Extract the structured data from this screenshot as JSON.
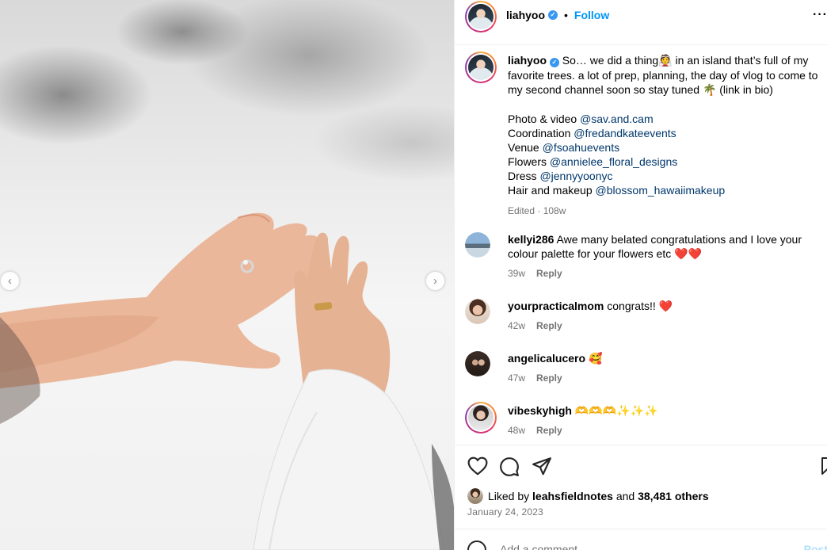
{
  "header": {
    "username": "liahyoo",
    "follow_label": "Follow",
    "separator": "•",
    "more": "···"
  },
  "caption": {
    "username": "liahyoo",
    "line1_a": "So… we did a thing",
    "line1_b": " in an island that’s full of my favorite trees. a lot of prep, planning, the day of vlog to come to my second channel soon so stay tuned ",
    "line1_c": " (link in bio)",
    "credits": [
      {
        "label": "Photo & video ",
        "handle": "@sav.and.cam"
      },
      {
        "label": "Coordination ",
        "handle": "@fredandkateevents"
      },
      {
        "label": "Venue ",
        "handle": "@fsoahuevents"
      },
      {
        "label": "Flowers ",
        "handle": "@annielee_floral_designs"
      },
      {
        "label": "Dress ",
        "handle": "@jennyyoonyc"
      },
      {
        "label": "Hair and makeup ",
        "handle": "@blossom_hawaiimakeup"
      }
    ],
    "meta": "Edited · 108w"
  },
  "comments": [
    {
      "username": "kellyi286",
      "text": "Awe many belated congratulations and I love your colour palette for your flowers etc ",
      "emoji": "❤️❤️",
      "age": "39w",
      "reply": "Reply"
    },
    {
      "username": "yourpracticalmom",
      "text": "congrats!! ",
      "emoji": "❤️",
      "age": "42w",
      "reply": "Reply"
    },
    {
      "username": "angelicalucero",
      "text": "",
      "emoji": "🥰",
      "age": "47w",
      "reply": "Reply"
    },
    {
      "username": "vibeskyhigh",
      "text": "",
      "emoji": "🫶🫶🫶✨✨✨",
      "age": "48w",
      "reply": "Reply"
    }
  ],
  "likes": {
    "prefix": "Liked by",
    "liker": "leahsfieldnotes",
    "and": "and",
    "others": "38,481 others"
  },
  "post_date": "January 24, 2023",
  "add_comment": {
    "placeholder": "Add a comment…",
    "post_label": "Post"
  },
  "icons": {
    "like": "heart-icon",
    "comment": "comment-icon",
    "share": "paper-plane-icon",
    "save": "bookmark-icon",
    "prev": "chevron-left-icon",
    "next": "chevron-right-icon"
  },
  "colors": {
    "link": "#00376b",
    "follow": "#0095f6",
    "verified": "#3897f0",
    "heart": "#ed4956",
    "muted": "#737373"
  }
}
